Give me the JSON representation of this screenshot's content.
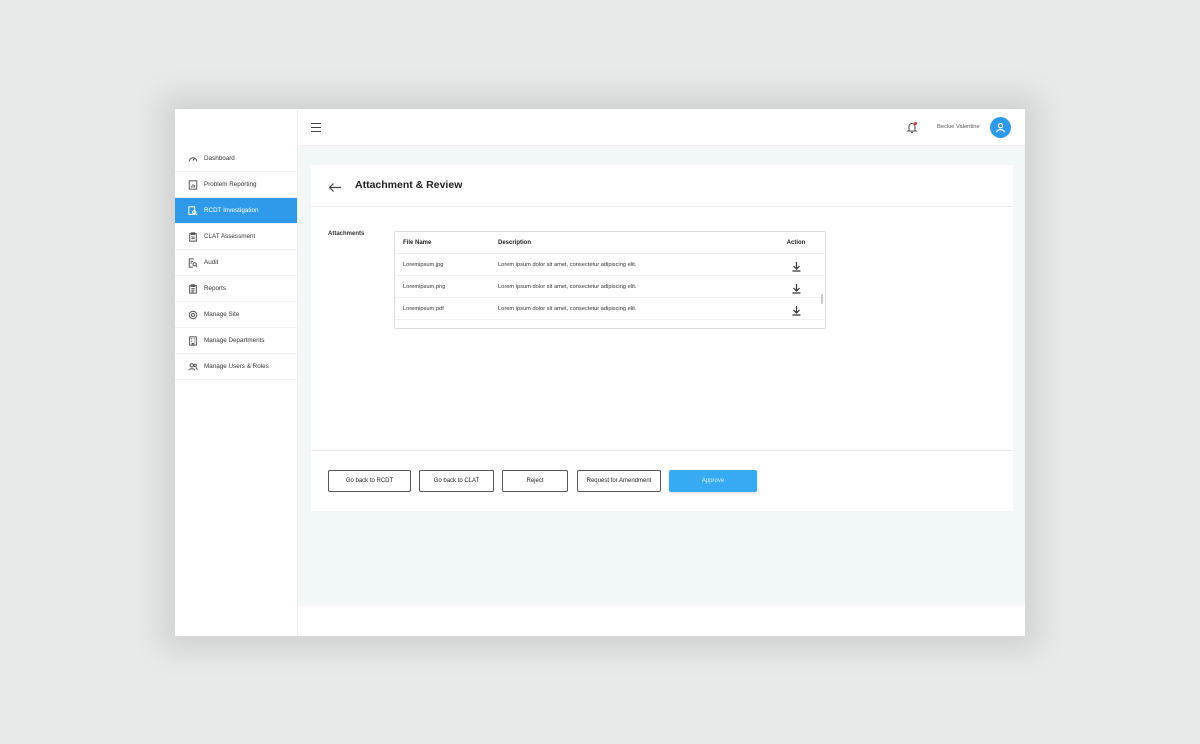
{
  "sidebar": {
    "items": [
      {
        "label": "Dashboard",
        "icon": "gauge-icon"
      },
      {
        "label": "Problem Reporting",
        "icon": "report-chart-icon"
      },
      {
        "label": "RCDT Investigation",
        "icon": "investigation-icon",
        "active": true
      },
      {
        "label": "CLAT Assessment",
        "icon": "clipboard-icon"
      },
      {
        "label": "Audit",
        "icon": "audit-search-icon"
      },
      {
        "label": "Reports",
        "icon": "reports-clipboard-icon"
      },
      {
        "label": "Manage Site",
        "icon": "site-gear-icon"
      },
      {
        "label": "Manage Departments",
        "icon": "building-icon"
      },
      {
        "label": "Manage Users & Roles",
        "icon": "users-icon"
      }
    ]
  },
  "topbar": {
    "menu_icon": "hamburger-menu-icon",
    "notification_icon": "bell-icon",
    "user_name": "Beckie Valentine",
    "avatar_icon": "user-avatar-icon"
  },
  "page": {
    "title": "Attachment & Review",
    "back_icon": "back-arrow-icon",
    "attachments_label": "Attachments"
  },
  "table": {
    "headers": {
      "file": "File Name",
      "description": "Description",
      "action": "Action"
    },
    "rows": [
      {
        "file": "Loremipsum.jpg",
        "description": "Lorem ipsum dolor sit amet, consectetur adipiscing elit."
      },
      {
        "file": "Loremipsum.png",
        "description": "Lorem ipsum dolor sit amet, consectetur adipiscing elit."
      },
      {
        "file": "Loremipsum.pdf",
        "description": "Lorem ipsum dolor sit amet, consectetur adipiscing elit."
      }
    ]
  },
  "actions": {
    "go_back_rcdt": "Go back to RCDT",
    "go_back_clat": "Go back to CLAT",
    "reject": "Reject",
    "request_amendment": "Request for Amendment",
    "approve": "Approve"
  },
  "colors": {
    "accent": "#2f9ae9",
    "primary_button": "#36aaf2",
    "main_background": "#f2f7f7",
    "page_background": "#e8e9e9"
  }
}
